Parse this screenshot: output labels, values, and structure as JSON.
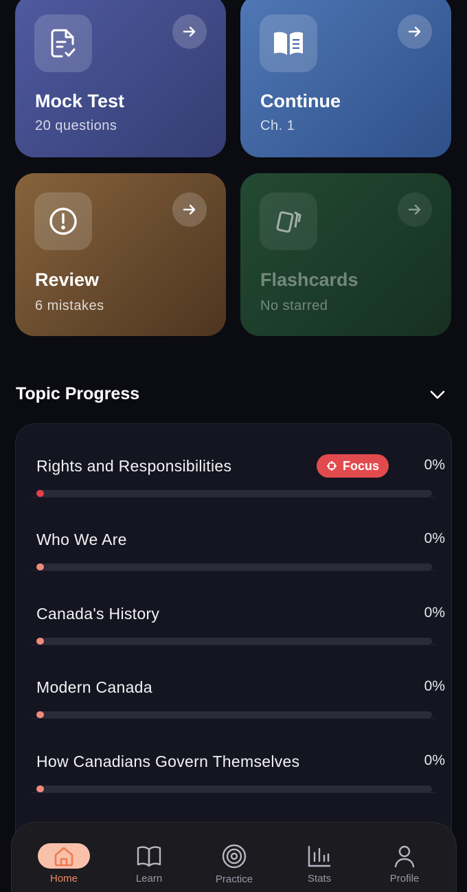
{
  "cards": {
    "mock": {
      "title": "Mock Test",
      "subtitle": "20 questions",
      "icon": "document-check-icon"
    },
    "continue": {
      "title": "Continue",
      "subtitle": "Ch. 1",
      "icon": "open-book-icon"
    },
    "review": {
      "title": "Review",
      "subtitle": "6 mistakes",
      "icon": "alert-circle-icon"
    },
    "flashcards": {
      "title": "Flashcards",
      "subtitle": "No starred",
      "icon": "cards-icon"
    }
  },
  "topic_progress": {
    "title": "Topic Progress",
    "topics": [
      {
        "name": "Rights and Responsibilities",
        "percent": "0%",
        "badge": "Focus",
        "progress": 0
      },
      {
        "name": "Who We Are",
        "percent": "0%",
        "progress": 0
      },
      {
        "name": "Canada's History",
        "percent": "0%",
        "progress": 0
      },
      {
        "name": "Modern Canada",
        "percent": "0%",
        "progress": 0
      },
      {
        "name": "How Canadians Govern Themselves",
        "percent": "0%",
        "progress": 0
      }
    ]
  },
  "nav": {
    "items": [
      {
        "label": "Home",
        "icon": "home-icon",
        "active": true
      },
      {
        "label": "Learn",
        "icon": "book-icon",
        "active": false
      },
      {
        "label": "Practice",
        "icon": "target-icon",
        "active": false
      },
      {
        "label": "Stats",
        "icon": "bar-chart-icon",
        "active": false
      },
      {
        "label": "Profile",
        "icon": "user-icon",
        "active": false
      }
    ]
  },
  "colors": {
    "accent": "#f08a68",
    "focus_badge": "#e24b4e",
    "background": "#0b0b12"
  }
}
